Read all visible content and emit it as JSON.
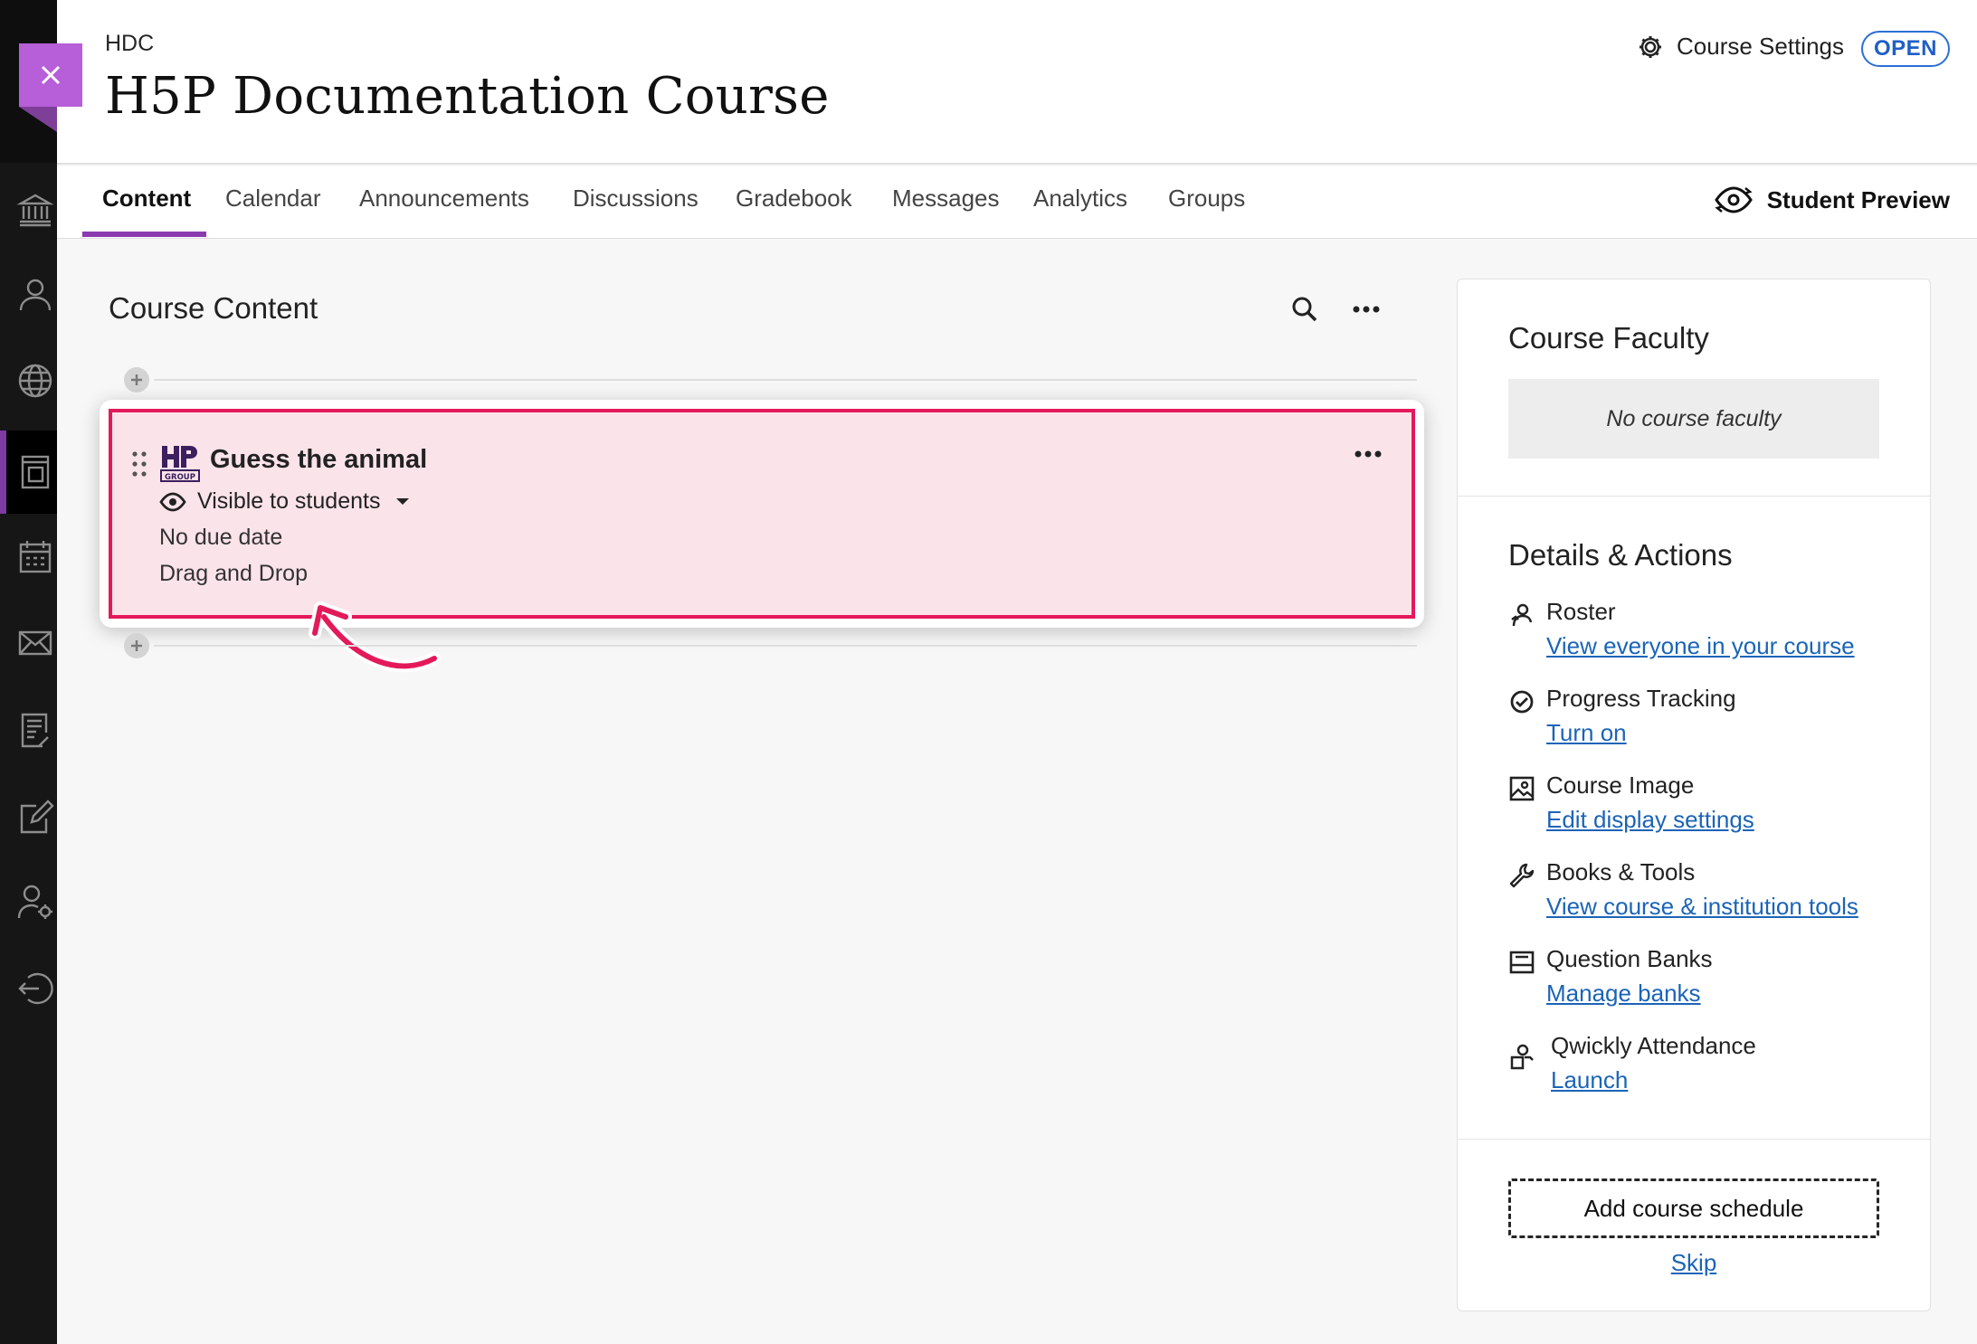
{
  "header": {
    "course_code": "HDC",
    "course_title": "H5P Documentation Course",
    "settings_label": "Course Settings",
    "status_badge": "OPEN"
  },
  "tabs": [
    {
      "label": "Content",
      "active": true
    },
    {
      "label": "Calendar"
    },
    {
      "label": "Announcements"
    },
    {
      "label": "Discussions"
    },
    {
      "label": "Gradebook"
    },
    {
      "label": "Messages"
    },
    {
      "label": "Analytics"
    },
    {
      "label": "Groups"
    }
  ],
  "student_preview_label": "Student Preview",
  "nav_rail": {
    "icons": [
      "institution-icon",
      "profile-icon",
      "globe-icon",
      "courses-icon",
      "calendar-icon",
      "mail-icon",
      "grades-icon",
      "edit-icon",
      "tools-icon",
      "sign-out-icon"
    ]
  },
  "content": {
    "title": "Course Content",
    "item": {
      "title": "Guess the animal",
      "visibility": "Visible to students",
      "due": "No due date",
      "type": "Drag and Drop",
      "logo_text": "GROUP"
    }
  },
  "sidebar": {
    "faculty_title": "Course Faculty",
    "faculty_empty": "No course faculty",
    "details_title": "Details & Actions",
    "details": [
      {
        "label": "Roster",
        "link": "View everyone in your course",
        "icon": "roster-icon"
      },
      {
        "label": "Progress Tracking",
        "link": "Turn on",
        "icon": "check-circle-icon"
      },
      {
        "label": "Course Image",
        "link": "Edit display settings",
        "icon": "image-icon"
      },
      {
        "label": "Books & Tools",
        "link": "View course & institution tools",
        "icon": "wrench-icon"
      },
      {
        "label": "Question Banks",
        "link": "Manage banks",
        "icon": "question-bank-icon"
      },
      {
        "label": "Qwickly Attendance",
        "link": "Launch",
        "icon": "attendance-icon"
      }
    ],
    "schedule_button": "Add course schedule",
    "skip_link": "Skip"
  },
  "colors": {
    "accent_purple": "#8a3bb0",
    "close_tab": "#b65fd8",
    "highlight_border": "#e31a5a",
    "highlight_fill": "#fbe3ea",
    "link": "#1b64b8",
    "badge_blue": "#2b6fd6"
  }
}
